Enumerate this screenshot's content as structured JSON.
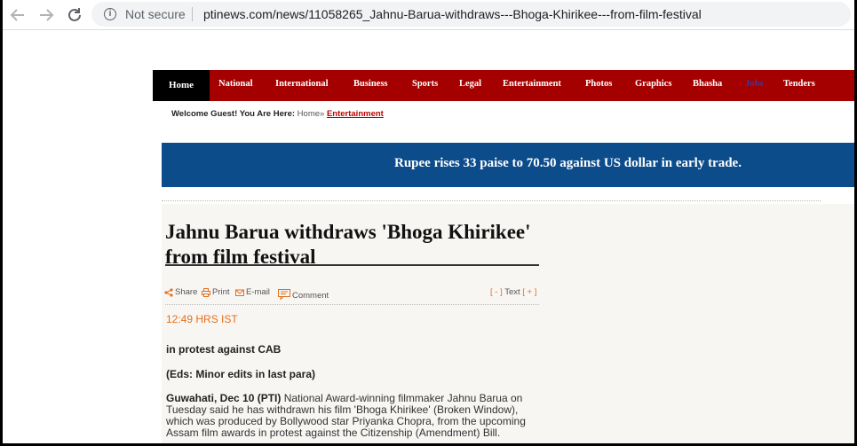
{
  "browser": {
    "not_secure": "Not secure",
    "url": "ptinews.com/news/11058265_Jahnu-Barua-withdraws---Bhoga-Khirikee---from-film-festival"
  },
  "menu": {
    "home": "Home",
    "items": [
      "National",
      "International",
      "Business",
      "Sports",
      "Legal",
      "Entertainment",
      "Photos",
      "Graphics",
      "Bhasha",
      "Jobs",
      "Tenders"
    ]
  },
  "breadcrumb": {
    "welcome": "Welcome Guest! You Are Here:",
    "home": "Home",
    "separator": "»",
    "current": "Entertainment"
  },
  "ticker": "Rupee rises 33 paise to 70.50 against US dollar in early trade.",
  "article": {
    "headline": "Jahnu Barua withdraws 'Bhoga Khirikee' from film festival",
    "tools": {
      "share": "Share",
      "print": "Print",
      "email": "E-mail",
      "comment": "Comment"
    },
    "text_size": {
      "minus": "[ - ]",
      "label": "Text",
      "plus": "[ + ]"
    },
    "time": "12:49 HRS IST",
    "subhead": "in protest against CAB",
    "eds_note": "(Eds: Minor edits in last para)",
    "dateline": "Guwahati, Dec 10 (PTI)",
    "body": "National Award-winning filmmaker Jahnu Barua on Tuesday said he has withdrawn his film 'Bhoga Khirikee' (Broken Window), which was produced by Bollywood star Priyanka Chopra, from the upcoming Assam film awards in protest against the Citizenship (Amendment) Bill."
  },
  "colors": {
    "menu_bg": "#a50000",
    "ticker_bg": "#0d4c8a",
    "accent_orange": "#e07020",
    "link_red": "#c00000"
  }
}
